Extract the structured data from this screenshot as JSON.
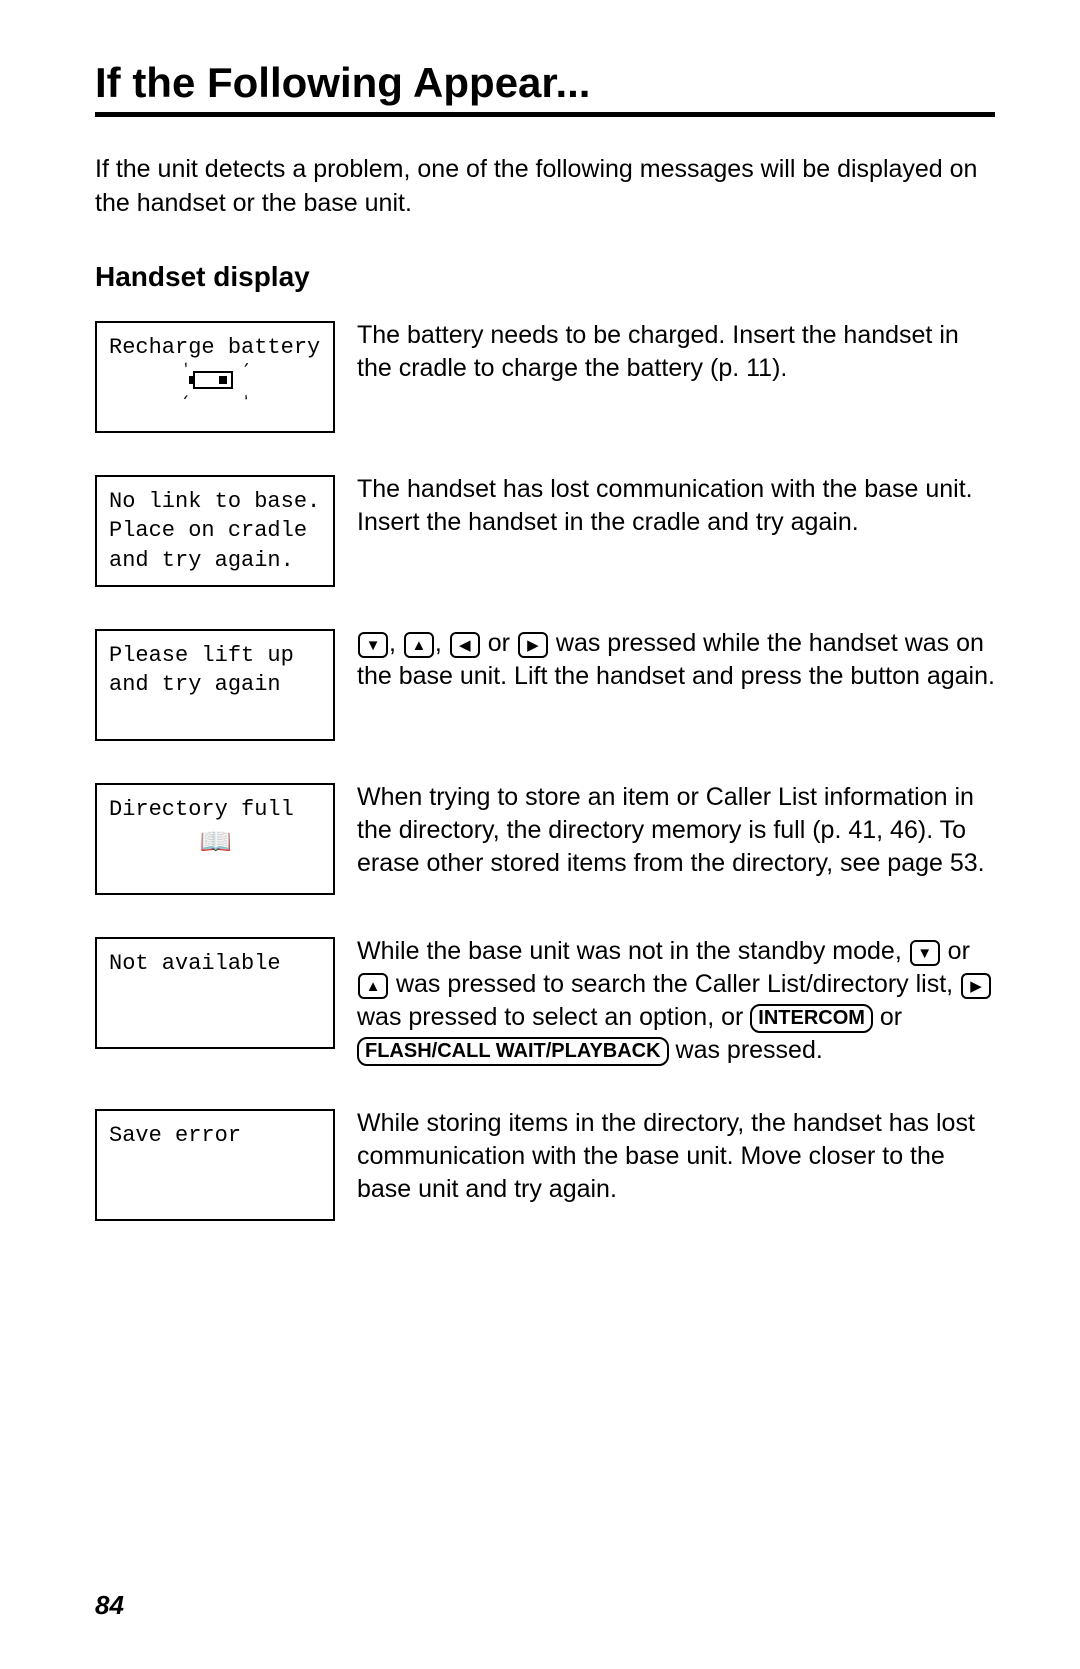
{
  "page_number": "84",
  "title": "If the Following Appear...",
  "intro": "If the unit detects a problem, one of the following messages will be displayed on the handset or the base unit.",
  "subhead": "Handset display",
  "buttons": {
    "intercom": "INTERCOM",
    "flash_call_wait_playback": "FLASH/CALL WAIT/PLAYBACK"
  },
  "rows": [
    {
      "lcd": "Recharge battery",
      "icon": "battery",
      "desc": "The battery needs to be charged. Insert the handset in the cradle to charge the battery (p. 11)."
    },
    {
      "lcd": "No link to base.\nPlace on cradle\nand try again.",
      "desc": "The handset has lost communication with the base unit. Insert the handset in the cradle and try again."
    },
    {
      "lcd": "Please lift up\nand try again",
      "desc_pre": "",
      "arrows4": true,
      "desc_post": " was pressed while the handset was on the base unit. Lift the handset and press the button again."
    },
    {
      "lcd": "Directory full",
      "icon": "book",
      "desc": "When trying to store an item or Caller List information in the directory, the directory memory is full (p. 41, 46). To erase other stored items from the directory, see page 53."
    },
    {
      "lcd": "Not available",
      "desc_p1": "While the base unit was not in the standby mode, ",
      "desc_p2": " was pressed to search the Caller List/directory list, ",
      "desc_p3": " was pressed to select an option, or ",
      "desc_p4": " or ",
      "desc_p5": " was pressed."
    },
    {
      "lcd": "Save error",
      "desc": "While storing items in the directory, the handset has lost communication with the base unit. Move closer to the base unit and try again."
    }
  ]
}
